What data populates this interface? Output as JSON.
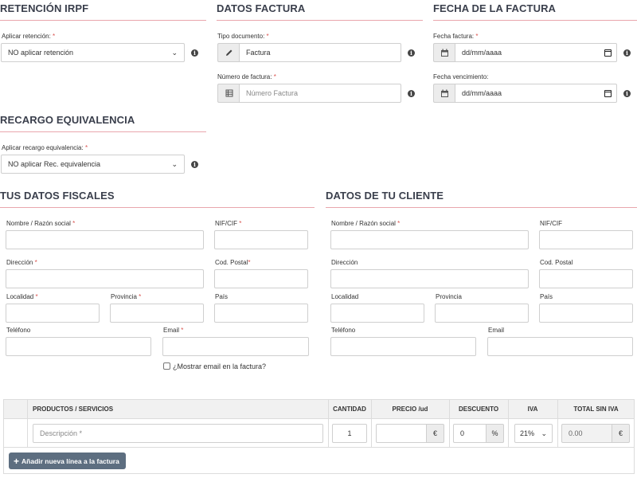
{
  "retencion": {
    "title": "RETENCIÓN IRPF",
    "label": "Aplicar retención:",
    "value": "NO aplicar retención"
  },
  "recargo": {
    "title": "RECARGO EQUIVALENCIA",
    "label": "Aplicar recargo equivalencia:",
    "value": "NO aplicar Rec. equivalencia"
  },
  "datos_factura": {
    "title": "DATOS FACTURA",
    "tipo_label": "Tipo documento:",
    "tipo_value": "Factura",
    "numero_label": "Número de factura:",
    "numero_placeholder": "Número Factura"
  },
  "fecha": {
    "title": "FECHA DE LA FACTURA",
    "fecha_label": "Fecha factura:",
    "fecha_value": "dd/mm/aaaa",
    "venc_label": "Fecha vencimiento:",
    "venc_value": "dd/mm/aaaa"
  },
  "fiscales": {
    "title": "TUS DATOS FISCALES",
    "nombre": "Nombre / Razón social",
    "nif": "NIF/CIF",
    "direccion": "Dirección",
    "cp": "Cod. Postal",
    "localidad": "Localidad",
    "provincia": "Provincia",
    "pais": "País",
    "telefono": "Teléfono",
    "email": "Email",
    "mostrar_email": "¿Mostrar email en la factura?"
  },
  "cliente": {
    "title": "DATOS DE TU CLIENTE",
    "nombre": "Nombre / Razón social",
    "nif": "NIF/CIF",
    "direccion": "Dirección",
    "cp": "Cod. Postal",
    "localidad": "Localidad",
    "provincia": "Provincia",
    "pais": "País",
    "telefono": "Teléfono",
    "email": "Email"
  },
  "required_mark": "*",
  "table": {
    "headers": {
      "productos": "PRODUCTOS / SERVICIOS",
      "cantidad": "CANTIDAD",
      "precio": "PRECIO /ud",
      "descuento": "DESCUENTO",
      "iva": "IVA",
      "total": "TOTAL SIN IVA"
    },
    "row": {
      "descripcion_placeholder": "Descripción *",
      "cantidad": "1",
      "precio_suffix": "€",
      "descuento": "0",
      "descuento_suffix": "%",
      "iva": "21%",
      "total": "0.00",
      "total_suffix": "€"
    },
    "add_button": "Añadir nueva línea a la factura"
  },
  "colors": {
    "section_line": "#e9a6ad",
    "button_bg": "#5d6e80",
    "required": "#d9534f"
  },
  "icons": {
    "info": "info-circle-icon",
    "pencil": "pencil-icon",
    "list": "list-icon",
    "calendar": "calendar-icon",
    "chevron": "chevron-down-icon",
    "plus": "plus-icon"
  }
}
